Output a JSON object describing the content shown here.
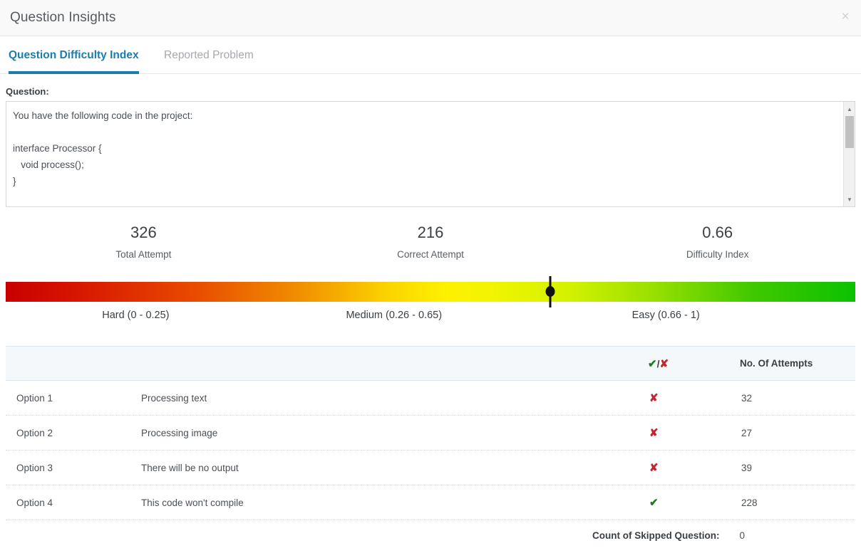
{
  "modal": {
    "title": "Question Insights",
    "close_icon": "close-icon",
    "close_glyph": "×"
  },
  "tabs": [
    {
      "label": "Question Difficulty Index",
      "active": true
    },
    {
      "label": "Reported Problem",
      "active": false
    }
  ],
  "question": {
    "label": "Question:",
    "body": "You have the following code in the project:\n\ninterface Processor {\n   void process();\n}\n",
    "scrollbar": {
      "up_arrow": "▲",
      "down_arrow": "▼"
    }
  },
  "stats": [
    {
      "value": "326",
      "label": "Total Attempt"
    },
    {
      "value": "216",
      "label": "Correct Attempt"
    },
    {
      "value": "0.66",
      "label": "Difficulty Index"
    }
  ],
  "meter": {
    "marker_position_pct": 64.1,
    "bands": [
      {
        "label": "Hard (0 - 0.25)",
        "center_pct": 15.3
      },
      {
        "label": "Medium (0.26 - 0.65)",
        "center_pct": 45.7
      },
      {
        "label": "Easy (0.66 - 1)",
        "center_pct": 77.7
      }
    ],
    "colors": {
      "hard": "#c80000",
      "medium": "#fdf200",
      "easy": "#0cc200",
      "marker": "#111111"
    }
  },
  "table": {
    "headers": {
      "option": "",
      "text": "",
      "mark": "✔/✘",
      "mark_correct_glyph": "✔",
      "mark_separator": "/",
      "mark_wrong_glyph": "✘",
      "count": "No. Of Attempts"
    },
    "rows": [
      {
        "option": "Option 1",
        "text": "Processing text",
        "correct": false,
        "mark": "✘",
        "attempts": "32"
      },
      {
        "option": "Option 2",
        "text": "Processing image",
        "correct": false,
        "mark": "✘",
        "attempts": "27"
      },
      {
        "option": "Option 3",
        "text": "There will be no output",
        "correct": false,
        "mark": "✘",
        "attempts": "39"
      },
      {
        "option": "Option 4",
        "text": "This code won't compile",
        "correct": true,
        "mark": "✔",
        "attempts": "228"
      }
    ]
  },
  "footer": {
    "skipped_label": "Count of Skipped Question:",
    "skipped_value": "0"
  },
  "theme": {
    "accent": "#1c7dad",
    "header_bg": "#f9f9f9",
    "table_head_bg": "#f4f8fb",
    "correct_green": "#1e7b1e",
    "wrong_red": "#c1272d"
  }
}
